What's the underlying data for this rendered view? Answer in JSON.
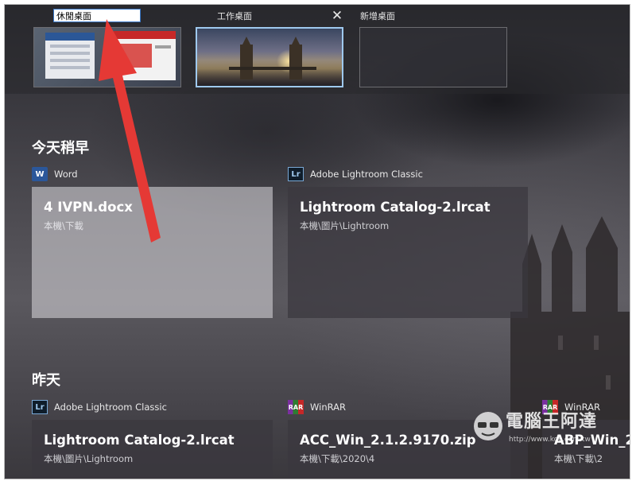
{
  "desktops": {
    "rename_value": "休閒桌面",
    "items": [
      {
        "name": "休閒桌面",
        "state": "renaming"
      },
      {
        "name": "工作桌面",
        "state": "active"
      },
      {
        "name": "新增桌面",
        "state": "new"
      }
    ],
    "close_icon": "close-icon"
  },
  "timeline": {
    "sections": [
      {
        "title": "今天稍早",
        "activities": [
          {
            "app": "Word",
            "icon": "word-icon",
            "title": "4 IVPN.docx",
            "path": "本機\\下載"
          },
          {
            "app": "Adobe Lightroom Classic",
            "icon": "lightroom-icon",
            "title": "Lightroom Catalog-2.lrcat",
            "path": "本機\\圖片\\Lightroom"
          }
        ]
      },
      {
        "title": "昨天",
        "activities": [
          {
            "app": "Adobe Lightroom Classic",
            "icon": "lightroom-icon",
            "title": "Lightroom Catalog-2.lrcat",
            "path": "本機\\圖片\\Lightroom"
          },
          {
            "app": "WinRAR",
            "icon": "winrar-icon",
            "title": "ACC_Win_2.1.2.9170.zip",
            "path": "本機\\下載\\2020\\4"
          },
          {
            "app": "WinRAR",
            "icon": "winrar-icon",
            "title": "ABP_Win_2",
            "path": "本機\\下載\\2"
          }
        ]
      }
    ]
  },
  "icon_glyphs": {
    "word": "W",
    "lightroom": "Lr",
    "winrar": "RAR"
  },
  "watermark": {
    "text": "電腦王阿達",
    "sub": "http://www.koc.com.tw"
  },
  "colors": {
    "accent_border": "#9fc9ee",
    "arrow": "#e53935",
    "input_border": "#3a78c8"
  }
}
